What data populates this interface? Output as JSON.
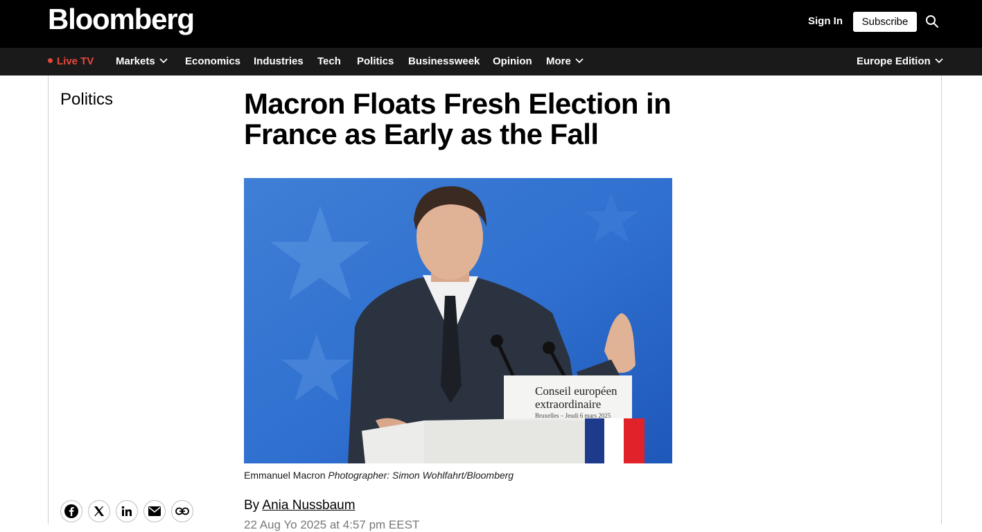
{
  "header": {
    "logo": "Bloomberg",
    "sign_in": "Sign In",
    "subscribe": "Subscribe",
    "search_icon": "search-icon"
  },
  "nav": {
    "live_tv": "Live TV",
    "items": [
      "Markets",
      "Economics",
      "Industries",
      "Tech",
      "Politics",
      "Businessweek",
      "Opinion",
      "More"
    ],
    "edition": "Europe Edition",
    "live_color": "#e8473b"
  },
  "article": {
    "section": "Politics",
    "headline": "Macron Floats Fresh Election in France as Early as the Fall",
    "caption_subject": "Emmanuel Macron",
    "caption_credit": "Photographer: Simon Wohlfahrt/Bloomberg",
    "byline_prefix": "By",
    "author": "Ania Nussbaum",
    "date": "22 Aug Yo 2025 at 4:57 pm EEST"
  },
  "photo": {
    "podium_line1": "Conseil européen",
    "podium_line2": "extraordinaire",
    "podium_line3": "Bruxelles – Jeudi 6 mars 2025"
  },
  "share": [
    "facebook-icon",
    "x-icon",
    "linkedin-icon",
    "email-icon",
    "link-icon"
  ]
}
